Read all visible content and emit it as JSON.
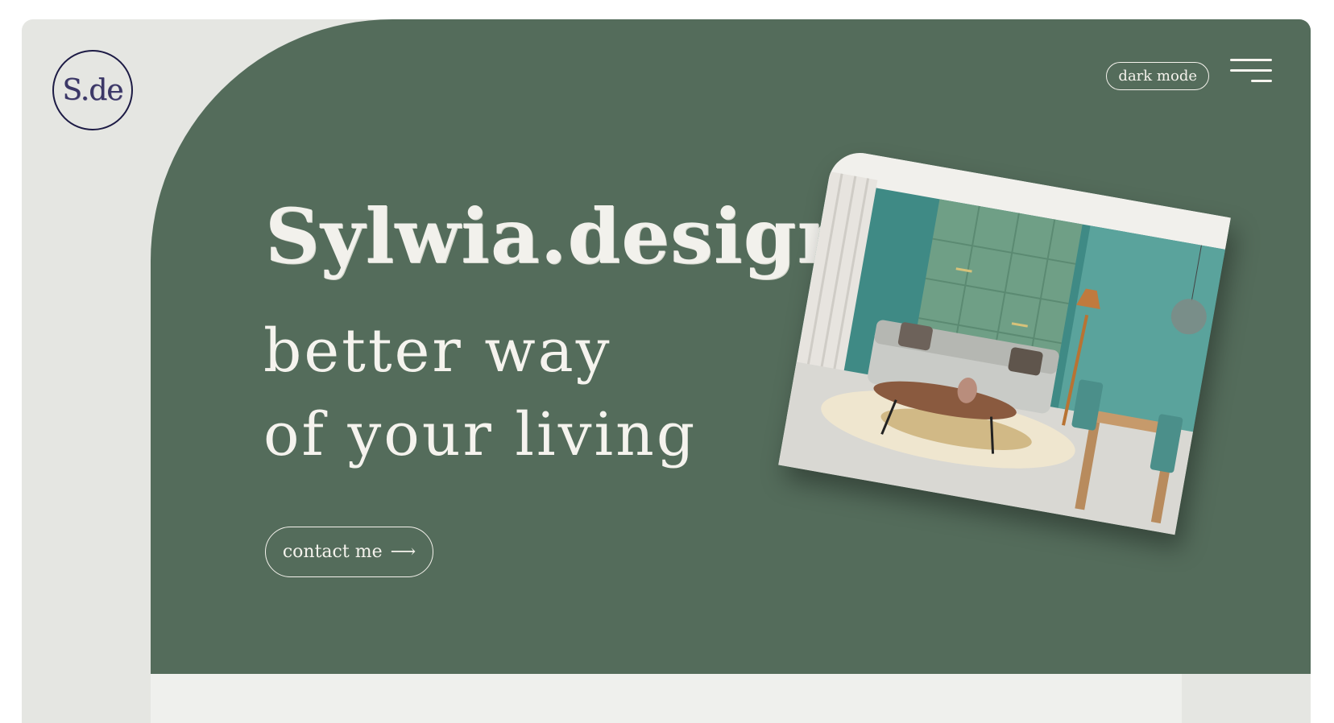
{
  "logo": {
    "text": "S.de"
  },
  "header": {
    "dark_mode_label": "dark mode"
  },
  "hero": {
    "title": "Sylwia.design",
    "tagline_line1": "better way",
    "tagline_line2": "of your living",
    "contact_label": "contact me",
    "contact_arrow": "⟶"
  },
  "icons": {
    "menu": "hamburger-menu-icon",
    "arrow": "arrow-right-icon"
  },
  "colors": {
    "hero_bg": "#546c5b",
    "page_bg": "#e5e6e2",
    "text_light": "#f4f2ec",
    "logo_ring": "#1d1b45"
  }
}
